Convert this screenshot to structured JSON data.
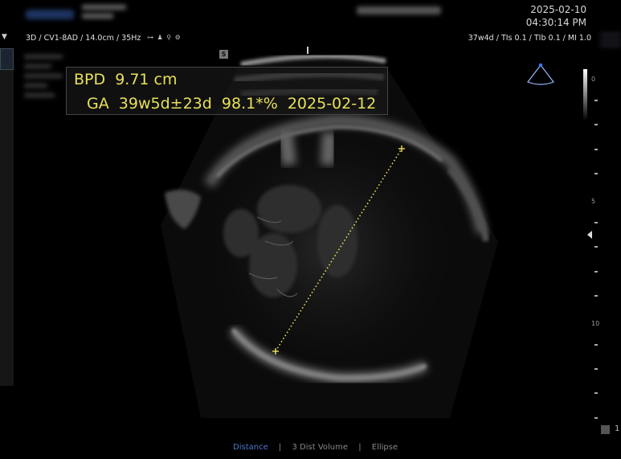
{
  "header": {
    "date": "2025-02-10",
    "time": "04:30:14 PM"
  },
  "info_bar": {
    "probe_info": "3D / CV1-8AD / 14.0cm / 35Hz",
    "safety_info": "37w4d / TIs  0.1 / TIb  0.1 / MI     1.0"
  },
  "image": {
    "marker_label": "S",
    "measurements": {
      "bpd": "BPD  9.71 cm",
      "ga": "GA  39w5d±23d  98.1*%  2025-02-12"
    },
    "depth_scale": {
      "labels": [
        "0",
        "5",
        "10"
      ]
    }
  },
  "bottom_menu": {
    "items": [
      "Distance",
      "3 Dist Volume",
      "Ellipse"
    ]
  },
  "right_checkbox_label": "1",
  "colors": {
    "measurement_text": "#e8e05a",
    "caliper": "#f0e060",
    "menu_active": "#4a78d0"
  },
  "icons": {
    "orientation": "probe-orientation-icon",
    "dropdown": "dropdown-arrow-icon",
    "focus": "focus-marker-icon"
  }
}
